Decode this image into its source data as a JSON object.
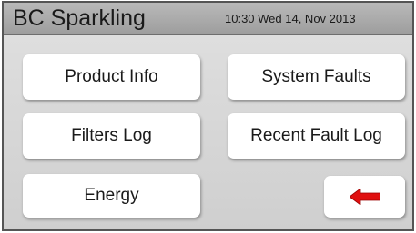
{
  "header": {
    "title": "BC Sparkling",
    "datetime": "10:30 Wed 14, Nov 2013"
  },
  "menu": {
    "product_info": "Product Info",
    "system_faults": "System Faults",
    "filters_log": "Filters Log",
    "recent_fault_log": "Recent Fault Log",
    "energy": "Energy"
  },
  "back_button": {
    "icon": "left-arrow-icon",
    "color": "#e01010"
  },
  "colors": {
    "header_bg": "#a8a8a8",
    "panel_bg": "#d8d8d8",
    "button_bg": "#ffffff",
    "accent_red": "#e01010"
  }
}
